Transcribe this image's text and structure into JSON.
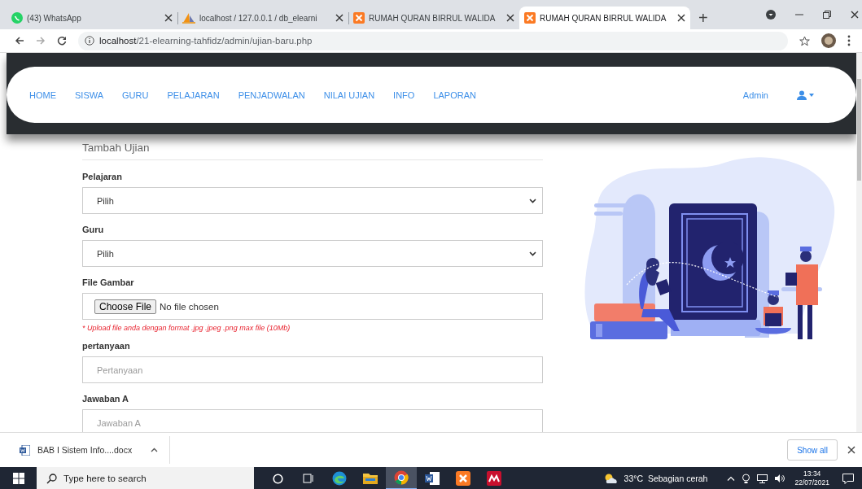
{
  "browser": {
    "tabs": [
      {
        "title": "(43) WhatsApp",
        "selected": false
      },
      {
        "title": "localhost / 127.0.0.1 / db_elearni",
        "selected": false
      },
      {
        "title": "RUMAH QURAN BIRRUL WALIDA",
        "selected": false
      },
      {
        "title": "RUMAH QURAN BIRRUL WALIDA",
        "selected": true
      }
    ],
    "new_tab": "+",
    "url_host": "localhost",
    "url_path": "/21-elearning-tahfidz/admin/ujian-baru.php"
  },
  "nav": {
    "items": [
      "HOME",
      "SISWA",
      "GURU",
      "PELAJARAN",
      "PENJADWALAN",
      "NILAI UJIAN",
      "INFO",
      "LAPORAN"
    ],
    "user": "Admin"
  },
  "form": {
    "title": "Tambah Ujian",
    "fields": [
      {
        "kind": "select",
        "label": "Pelajaran",
        "value": "Pilih"
      },
      {
        "kind": "select",
        "label": "Guru",
        "value": "Pilih"
      },
      {
        "kind": "file",
        "label": "File Gambar",
        "button": "Choose File",
        "status": "No file chosen",
        "hint": "* Upload file anda dengan format .jpg .jpeg .png max file (10Mb)"
      },
      {
        "kind": "text",
        "label": "pertanyaan",
        "placeholder": "Pertanyaan"
      },
      {
        "kind": "text",
        "label": "Jawaban A",
        "placeholder": "Jawaban A"
      }
    ]
  },
  "downloads": {
    "file": "BAB I Sistem Info....docx",
    "show_all": "Show all"
  },
  "taskbar": {
    "search": "Type here to search",
    "apps": [
      {
        "kind": "cortana",
        "selected": false
      },
      {
        "kind": "taskview",
        "selected": false
      },
      {
        "kind": "edge",
        "selected": false
      },
      {
        "kind": "explorer",
        "selected": false
      },
      {
        "kind": "chrome",
        "selected": true
      },
      {
        "kind": "word",
        "selected": false
      },
      {
        "kind": "xampp",
        "selected": false
      },
      {
        "kind": "redapp",
        "selected": false
      }
    ],
    "weather": "33°C  Sebagian cerah",
    "time": "13:34",
    "date": "22/07/2021"
  }
}
